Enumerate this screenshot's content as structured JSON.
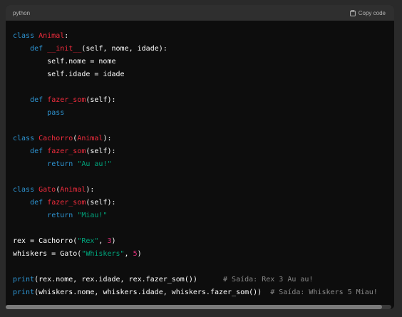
{
  "header": {
    "language": "python",
    "copy_label": "Copy code",
    "copy_icon": "clipboard-icon"
  },
  "code": {
    "lines": [
      [
        [
          "kw",
          "class "
        ],
        [
          "fn",
          "Animal"
        ],
        [
          "tx",
          ":"
        ]
      ],
      [
        [
          "tx",
          "    "
        ],
        [
          "kw",
          "def "
        ],
        [
          "fn",
          "__init__"
        ],
        [
          "tx",
          "(self, nome, idade):"
        ]
      ],
      [
        [
          "tx",
          "        self.nome = nome"
        ]
      ],
      [
        [
          "tx",
          "        self.idade = idade"
        ]
      ],
      [
        [
          "tx",
          ""
        ]
      ],
      [
        [
          "tx",
          "    "
        ],
        [
          "kw",
          "def "
        ],
        [
          "fn",
          "fazer_som"
        ],
        [
          "tx",
          "(self):"
        ]
      ],
      [
        [
          "tx",
          "        "
        ],
        [
          "kw",
          "pass"
        ]
      ],
      [
        [
          "tx",
          ""
        ]
      ],
      [
        [
          "kw",
          "class "
        ],
        [
          "fn",
          "Cachorro"
        ],
        [
          "tx",
          "("
        ],
        [
          "fn",
          "Animal"
        ],
        [
          "tx",
          "):"
        ]
      ],
      [
        [
          "tx",
          "    "
        ],
        [
          "kw",
          "def "
        ],
        [
          "fn",
          "fazer_som"
        ],
        [
          "tx",
          "(self):"
        ]
      ],
      [
        [
          "tx",
          "        "
        ],
        [
          "kw",
          "return "
        ],
        [
          "str",
          "\"Au au!\""
        ]
      ],
      [
        [
          "tx",
          ""
        ]
      ],
      [
        [
          "kw",
          "class "
        ],
        [
          "fn",
          "Gato"
        ],
        [
          "tx",
          "("
        ],
        [
          "fn",
          "Animal"
        ],
        [
          "tx",
          "):"
        ]
      ],
      [
        [
          "tx",
          "    "
        ],
        [
          "kw",
          "def "
        ],
        [
          "fn",
          "fazer_som"
        ],
        [
          "tx",
          "(self):"
        ]
      ],
      [
        [
          "tx",
          "        "
        ],
        [
          "kw",
          "return "
        ],
        [
          "str",
          "\"Miau!\""
        ]
      ],
      [
        [
          "tx",
          ""
        ]
      ],
      [
        [
          "tx",
          "rex = Cachorro("
        ],
        [
          "str",
          "\"Rex\""
        ],
        [
          "tx",
          ", "
        ],
        [
          "num",
          "3"
        ],
        [
          "tx",
          ")"
        ]
      ],
      [
        [
          "tx",
          "whiskers = Gato("
        ],
        [
          "str",
          "\"Whiskers\""
        ],
        [
          "tx",
          ", "
        ],
        [
          "num",
          "5"
        ],
        [
          "tx",
          ")"
        ]
      ],
      [
        [
          "tx",
          ""
        ]
      ],
      [
        [
          "kw",
          "print"
        ],
        [
          "tx",
          "(rex.nome, rex.idade, rex.fazer_som())      "
        ],
        [
          "cm",
          "# Saída: Rex 3 Au au!"
        ]
      ],
      [
        [
          "kw",
          "print"
        ],
        [
          "tx",
          "(whiskers.nome, whiskers.idade, whiskers.fazer_som())  "
        ],
        [
          "cm",
          "# Saída: Whiskers 5 Miau!"
        ]
      ]
    ]
  },
  "colors": {
    "keyword": "#2e95d3",
    "name": "#f22c3d",
    "string": "#00a67d",
    "number": "#df3079",
    "comment": "#888888",
    "background": "#0d0d0d",
    "header": "#2f2f2f"
  },
  "scroll": {
    "horizontal_visible_fraction": 0.976
  }
}
